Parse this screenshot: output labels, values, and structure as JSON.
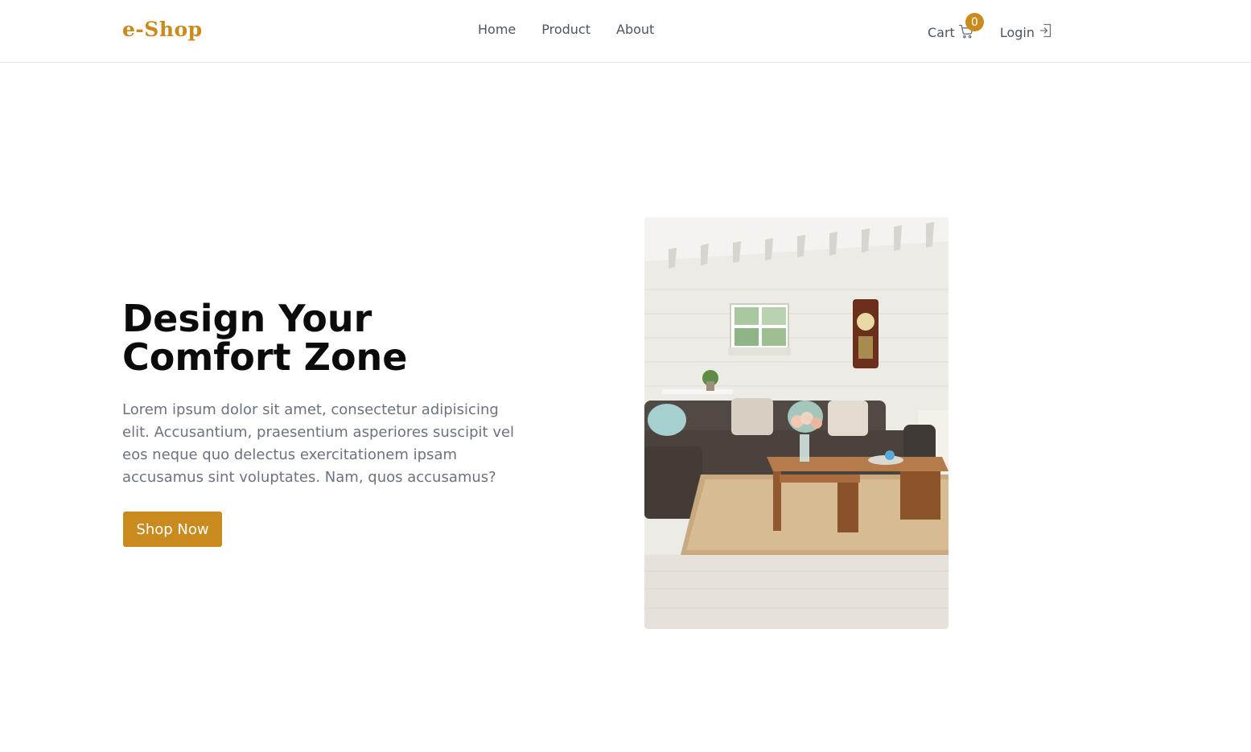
{
  "header": {
    "logo": "e-Shop",
    "nav": [
      "Home",
      "Product",
      "About"
    ],
    "cart_label": "Cart",
    "cart_count": "0",
    "login_label": "Login"
  },
  "hero": {
    "title": "Design Your Comfort Zone",
    "description": "Lorem ipsum dolor sit amet, consectetur adipisicing elit. Accusantium, praesentium asperiores suscipit vel eos neque quo delectus exercitationem ipsam accusamus sint voluptates. Nam, quos accusamus?",
    "cta_label": "Shop Now",
    "image_alt": "living-room-photo"
  },
  "colors": {
    "accent": "#c98a1e",
    "heading": "#0b0b0b",
    "body_text": "#6b7280",
    "nav_text": "#4b5563"
  }
}
